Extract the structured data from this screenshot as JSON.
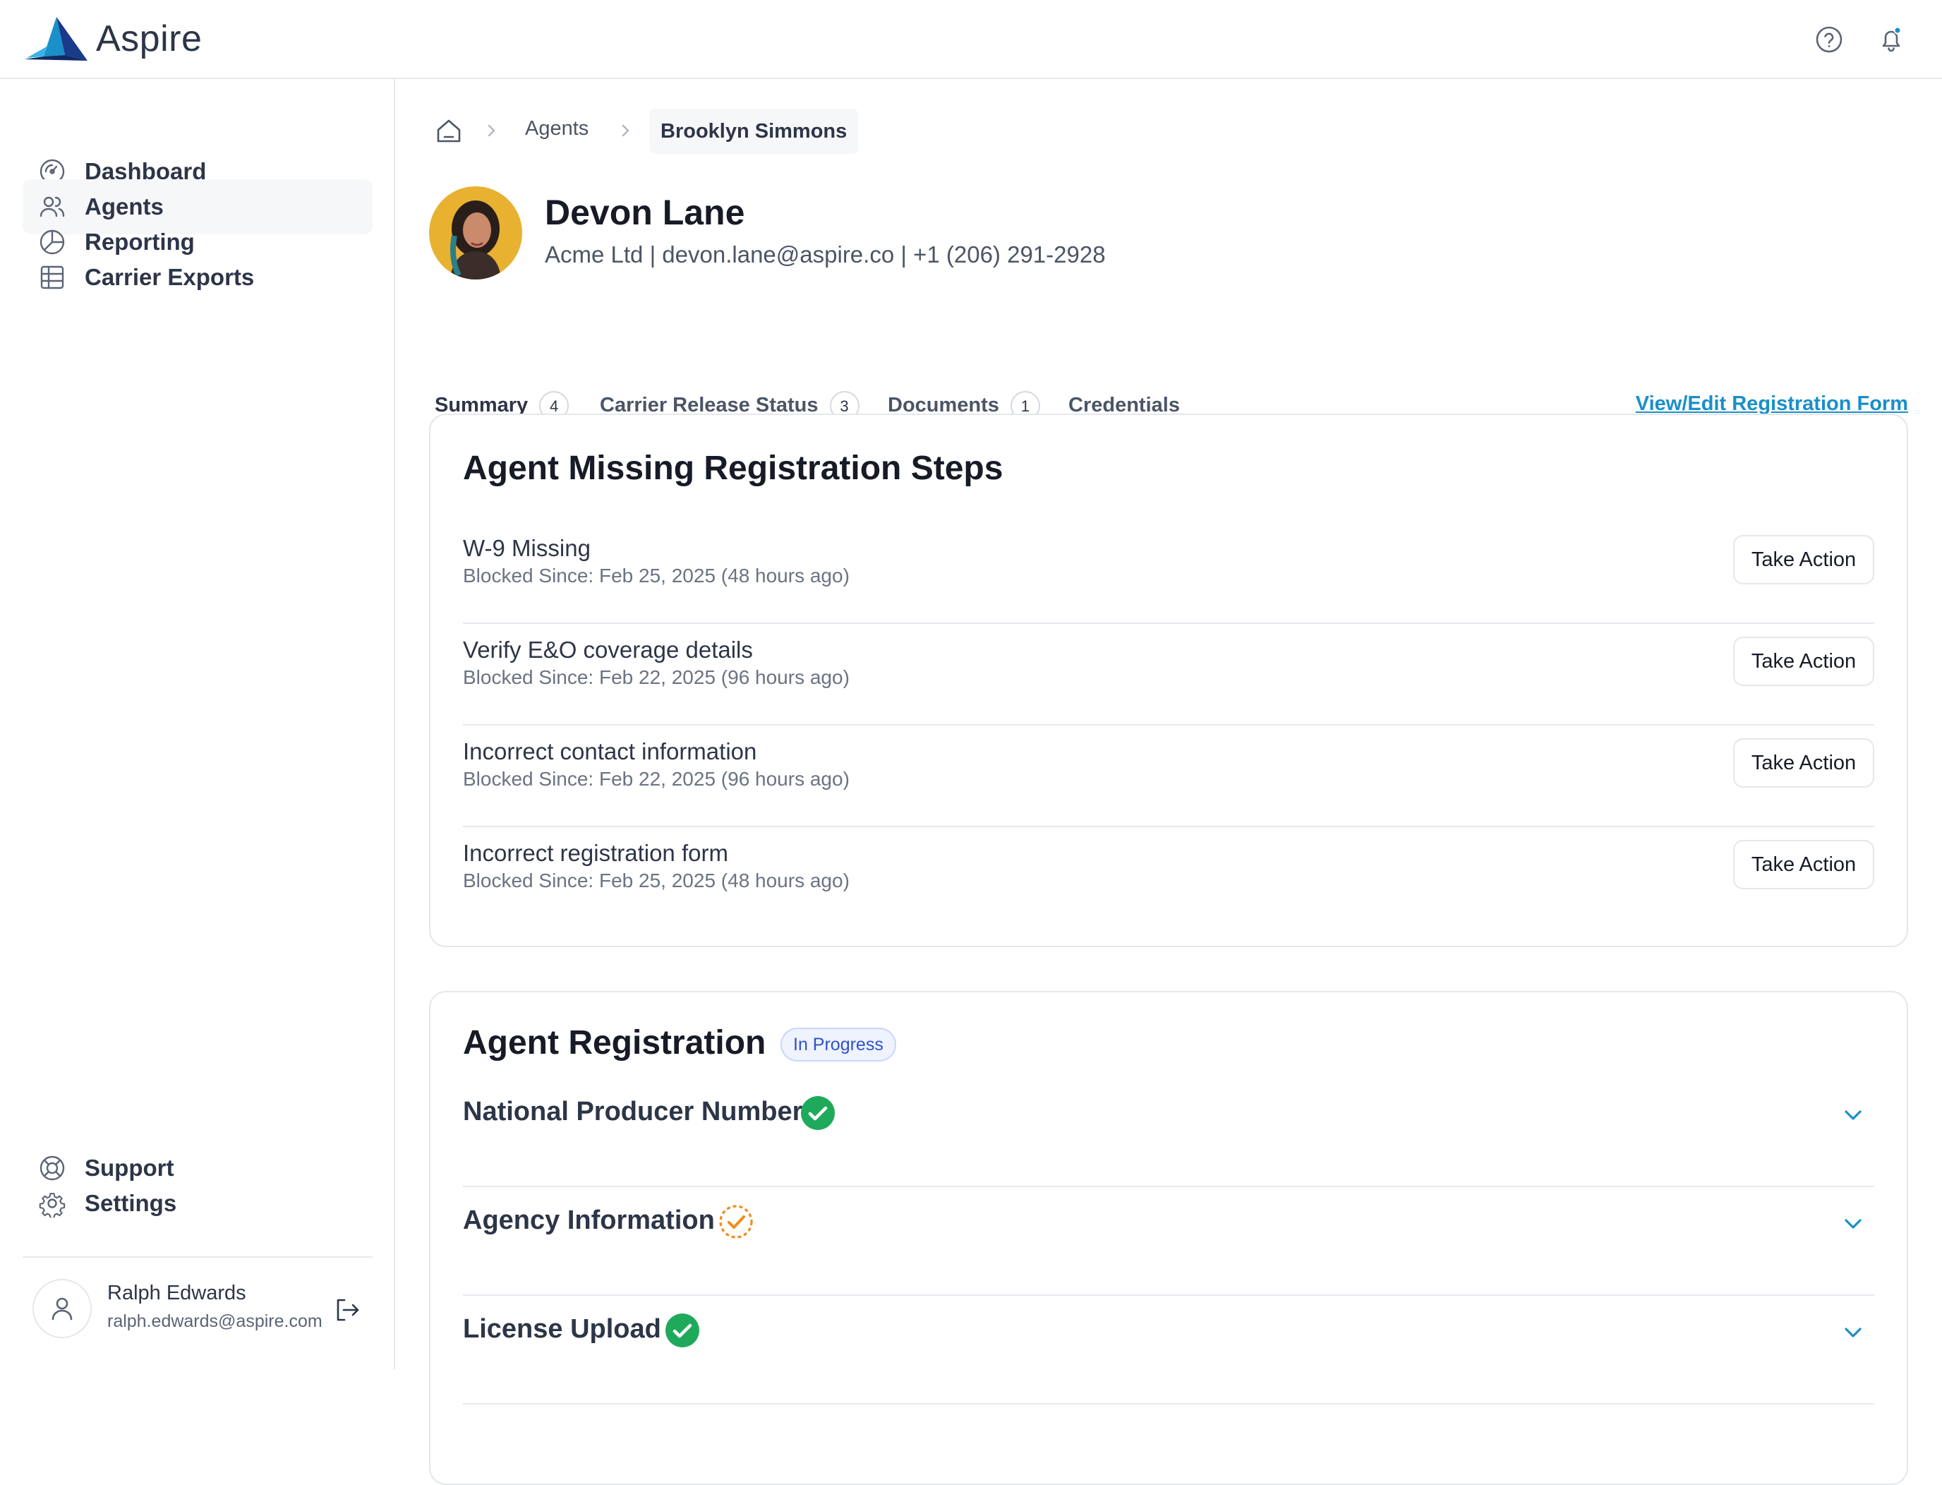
{
  "app": {
    "name": "Aspire",
    "brand_color": "#1a8fc9"
  },
  "header": {
    "icons": [
      "help-icon",
      "bell-icon"
    ]
  },
  "sidebar": {
    "items": [
      {
        "label": "Dashboard",
        "icon": "dashboard-icon"
      },
      {
        "label": "Agents",
        "icon": "users-icon",
        "active": true
      },
      {
        "label": "Reporting",
        "icon": "pie-chart-icon"
      },
      {
        "label": "Carrier Exports",
        "icon": "table-icon"
      }
    ],
    "bottom_items": [
      {
        "label": "Support",
        "icon": "support-icon"
      },
      {
        "label": "Settings",
        "icon": "gear-icon"
      }
    ],
    "user": {
      "name": "Ralph Edwards",
      "email": "ralph.edwards@aspire.com"
    }
  },
  "breadcrumb": {
    "items": [
      "Agents",
      "Brooklyn Simmons"
    ]
  },
  "profile": {
    "name": "Devon Lane",
    "info": "Acme Ltd | devon.lane@aspire.co | +1 (206) 291-2928"
  },
  "tabs": [
    {
      "label": "Summary",
      "count": "4",
      "active": true
    },
    {
      "label": "Carrier Release Status",
      "count": "3"
    },
    {
      "label": "Documents",
      "count": "1"
    },
    {
      "label": "Credentials",
      "count": ""
    }
  ],
  "view_edit_link": "View/Edit Registration Form",
  "missing_steps": {
    "title": "Agent Missing Registration Steps",
    "button_label": "Take Action",
    "items": [
      {
        "title": "W-9 Missing",
        "subtitle": "Blocked Since: Feb 25, 2025 (48 hours ago)"
      },
      {
        "title": "Verify E&O coverage details",
        "subtitle": "Blocked Since: Feb 22, 2025 (96 hours ago)"
      },
      {
        "title": "Incorrect contact information",
        "subtitle": "Blocked Since: Feb 22, 2025 (96 hours ago)"
      },
      {
        "title": "Incorrect registration form",
        "subtitle": "Blocked Since: Feb 25, 2025 (48 hours ago)"
      }
    ]
  },
  "registration": {
    "title": "Agent Registration",
    "status": "In Progress",
    "sections": [
      {
        "title": "National Producer Number",
        "status": "complete"
      },
      {
        "title": "Agency Information",
        "status": "pending"
      },
      {
        "title": "License Upload",
        "status": "complete"
      }
    ]
  }
}
